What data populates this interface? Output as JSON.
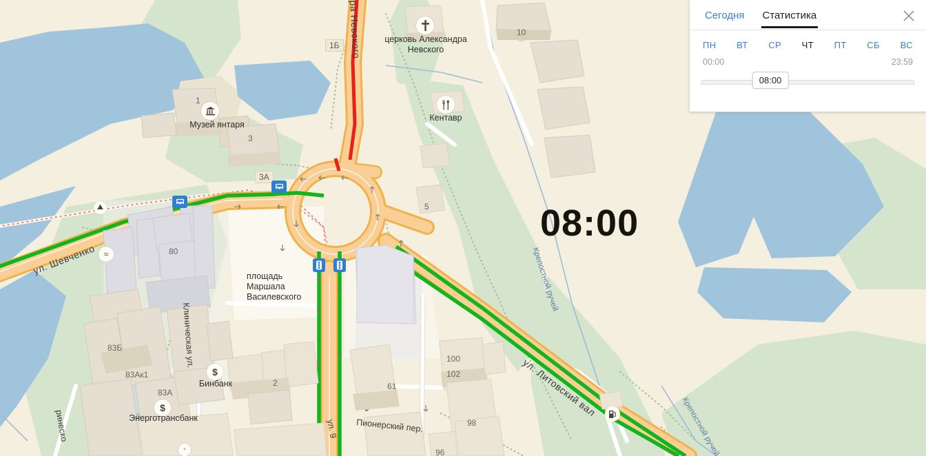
{
  "panel": {
    "tabs": [
      {
        "label": "Сегодня",
        "active": false
      },
      {
        "label": "Статистика",
        "active": true
      }
    ],
    "close_label": "×",
    "days": [
      {
        "label": "ПН",
        "active": false
      },
      {
        "label": "ВТ",
        "active": false
      },
      {
        "label": "СР",
        "active": false
      },
      {
        "label": "ЧТ",
        "active": true
      },
      {
        "label": "ПТ",
        "active": false
      },
      {
        "label": "СБ",
        "active": false
      },
      {
        "label": "ВС",
        "active": false
      }
    ],
    "time_start": "00:00",
    "time_end": "23:59",
    "slider_value": "08:00",
    "accent_color": "#3b7fd4"
  },
  "map": {
    "big_time": "08:00",
    "pois": [
      {
        "name": "Музей янтаря",
        "icon": "museum-icon",
        "glyph": "🏛"
      },
      {
        "name": "церковь Александра Невского",
        "icon": "church-icon",
        "glyph": "✝"
      },
      {
        "name": "Кентавр",
        "icon": "restaurant-icon",
        "glyph": "🍴"
      },
      {
        "name": "Бинбанк",
        "icon": "bank-icon",
        "glyph": "$"
      },
      {
        "name": "Энерготрансбанк",
        "icon": "bank-icon",
        "glyph": "$"
      }
    ],
    "poi_labels": {
      "museum": "Музей янтаря",
      "church_line1": "церковь Александра",
      "church_line2": "Невского",
      "restaurant": "Кентавр",
      "bank1": "Бинбанк",
      "bank2": "Энерготрансбанк"
    },
    "streets": [
      {
        "name": "ул. Александра Невского",
        "short": "ра Невского"
      },
      {
        "name": "ул. Шевченко",
        "short": "ул. Шевченко"
      },
      {
        "name": "Клиническая ул."
      },
      {
        "name": "Пионерский пер."
      },
      {
        "name": "ул. Литовский вал"
      },
      {
        "name": "ул. 9"
      },
      {
        "name": "ул. Маринеско",
        "short": "ринеско"
      }
    ],
    "street_labels": {
      "nevskogo": "ра Невского",
      "shevchenko": "ул. Шевченко",
      "klinicheskaya": "Клиническая ул.",
      "pionersky": "Пионерский пер.",
      "litovsky": "ул. Литовский вал",
      "ul9": "ул. 9",
      "marinesko": "ринеско"
    },
    "square_label_line1": "площадь",
    "square_label_line2": "Маршала",
    "square_label_line3": "Василевского",
    "water_labels": {
      "creek_upper": "Крепостной ручей",
      "creek_lower": "Крепостной ручей"
    },
    "building_numbers": [
      "1",
      "1Б",
      "3",
      "3А",
      "5",
      "10",
      "80",
      "2",
      "61",
      "83Б",
      "83Ак1",
      "83А",
      "100",
      "102",
      "98",
      "96"
    ],
    "bnum": {
      "n1": "1",
      "n1b": "1Б",
      "n3": "3",
      "n3a": "3А",
      "n5": "5",
      "n10": "10",
      "n80": "80",
      "n2": "2",
      "n61": "61",
      "n83b": "83Б",
      "n83ak1": "83Ак1",
      "n83a": "83А",
      "n100": "100",
      "n102": "102",
      "n98": "98",
      "n96": "96"
    },
    "traffic_colors": {
      "free": "#14b41e",
      "jam": "#e8201a",
      "road_major": "#f6b343",
      "road_fill": "#f7c98a",
      "road_minor": "#ffffff"
    },
    "palette": {
      "land": "#f4efdf",
      "green": "#d5e4cd",
      "water": "#a0c4dc",
      "building": "#e6ded0",
      "building_grey": "#dcdce2",
      "pedestrian": "#fbf8ef"
    }
  }
}
